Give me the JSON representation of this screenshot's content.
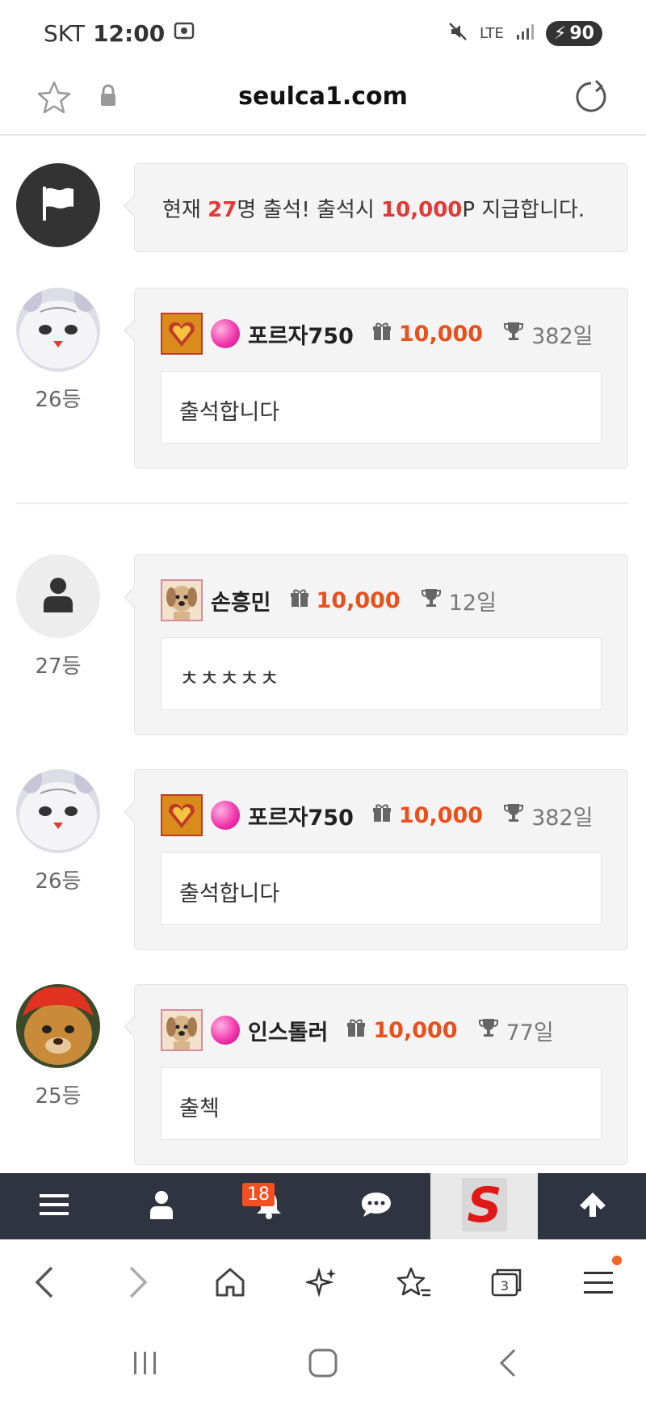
{
  "status_bar": {
    "carrier": "SKT",
    "time": "12:00",
    "network": "LTE",
    "battery": "90"
  },
  "address_bar": {
    "url": "seulca1.com"
  },
  "notice": {
    "prefix": "현재 ",
    "count": "27",
    "middle": "명 출석! 출석시 ",
    "points": "10,000",
    "suffix": "P 지급합니다."
  },
  "entries": [
    {
      "nickname": "포르자750",
      "points": "10,000",
      "days": "382일",
      "rank": "26등",
      "message": "출석합니다"
    },
    {
      "nickname": "손흥민",
      "points": "10,000",
      "days": "12일",
      "rank": "27등",
      "message": "ㅊㅊㅊㅊㅊ"
    },
    {
      "nickname": "포르자750",
      "points": "10,000",
      "days": "382일",
      "rank": "26등",
      "message": "출석합니다"
    },
    {
      "nickname": "인스톨러",
      "points": "10,000",
      "days": "77일",
      "rank": "25등",
      "message": "출첵"
    }
  ],
  "toolbar": {
    "notification_count": "18",
    "logo_letter": "S"
  },
  "browser_nav": {
    "tab_count": "3"
  },
  "colors": {
    "accent_red": "#e53935",
    "points_orange": "#e8501c",
    "toolbar_bg": "#2f3540"
  }
}
